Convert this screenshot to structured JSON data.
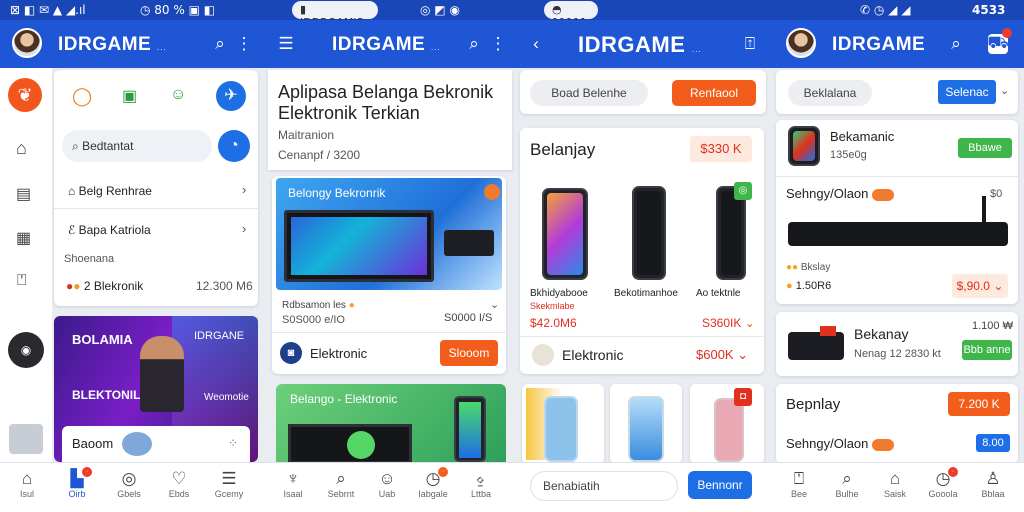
{
  "status": {
    "left_icons": "⊠ ◧ ✉ ▲ ◢.ıl",
    "battery_left": "◷ 80 % ▣ ◧",
    "center_pill": "▮ IDDROAMIS",
    "center_icons": "◎ ◩ ◉",
    "center_right_pill": "◓ 11111",
    "right_icons": "✆ ◷ ◢ ◢",
    "time": "4533"
  },
  "colors": {
    "primary": "#1e56d6",
    "accent": "#f25d1c",
    "success": "#3fb64a"
  },
  "p1": {
    "app_title": "IDRGAME",
    "title_suffix": "...",
    "search_icon": "search-icon",
    "menu_icon": "more-vert-icon",
    "quick_search_placeholder": "Bedtantat",
    "menu_items": [
      "Belg Renhrae",
      "Bapa Katriola"
    ],
    "section_label": "Shoenana",
    "elektronik_label": "2 Blekronik",
    "elektronik_price": "12.300 M6",
    "banner_title": "BOLAMIA",
    "banner_subtitle": "BLEKTONIL",
    "banner_brand": "IDRGANE",
    "banner_tag": "Weomotie",
    "banner_card_text": "Baoom",
    "nav": [
      "Isul",
      "Oirb",
      "Gbels",
      "Ebds",
      "Gcemy"
    ]
  },
  "p2": {
    "header_title": "IDRGAME",
    "title_suffix": "...",
    "heading": "Aplipasa Belanga Bekronik Elektronik Terkian",
    "subheading": "Maitranion",
    "subline": "Cenanpf / 3200",
    "promo_title": "Belongy Bekronrik",
    "promo_caption": "Rdbsamon les",
    "promo_sub": "S0S000 e/IO",
    "promo_price": "S0000 I/S",
    "row_label": "Elektronic",
    "row_button": "Slooom",
    "second_banner_title": "Belango - Elektronic",
    "nav": [
      "Isaal",
      "Sebrnt",
      "Uab",
      "Iabgale",
      "Lttba"
    ]
  },
  "p3": {
    "header_title": "IDRGAME",
    "title_suffix": "...",
    "pill_left": "Boad Belenhe",
    "pill_right": "Renfaool",
    "section_title": "Belanjay",
    "section_price": "$330 K",
    "products": [
      {
        "name": "Bkhidyabooe",
        "meta": "Skekmlabe",
        "price": "$42.0M6"
      },
      {
        "name": "Bekotimanhoe",
        "meta": "",
        "price": ""
      },
      {
        "name": "Ao tektnle",
        "meta": "",
        "price": "S360IK"
      }
    ],
    "row_label": "Elektronic",
    "row_price": "$600K",
    "bottom_input": "Benabiatih",
    "bottom_button": "Bennonr"
  },
  "p4": {
    "app_title": "IDRGAME",
    "pill_left": "Beklalana",
    "pill_right": "Selenac",
    "items": [
      {
        "title": "Bekamanic",
        "sub": "135e0g",
        "button": "Bbawe"
      },
      {
        "title": "Sehngy/Olaon",
        "sub": "",
        "button": ""
      },
      {
        "title": "Bekanay",
        "sub": "Nenag 12 2830 kt",
        "button": "Bbb anne",
        "price_top": "1.100 ₩"
      },
      {
        "title": "Bepnlay",
        "sub": "",
        "button": "7.200 K"
      },
      {
        "title": "Sehngy/Olaon",
        "sub": "",
        "button": "8.00"
      }
    ],
    "badge_small": "Bkslay",
    "price_left": "1.50R6",
    "price_right": "$,90.0",
    "nav": [
      "Bee",
      "Bulhe",
      "Saisk",
      "Gooola",
      "Bblaa"
    ]
  }
}
